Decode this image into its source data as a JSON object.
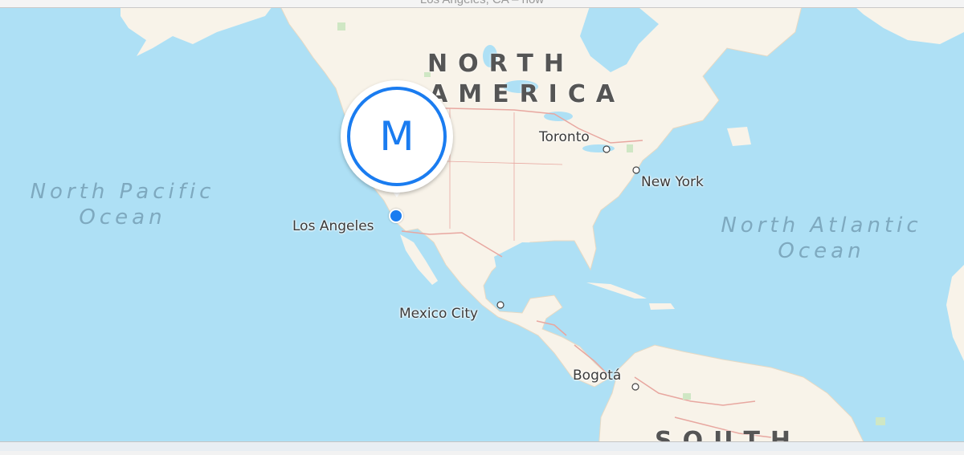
{
  "window": {
    "title": "Los Angeles, CA – now"
  },
  "colors": {
    "ocean": "#aee0f5",
    "land": "#f8f3e9",
    "border": "#e8a7a0",
    "pin": "#1a7cf0"
  },
  "map": {
    "continents": [
      {
        "id": "north-america",
        "line1": "NORTH",
        "line2": "AMERICA"
      },
      {
        "id": "south-america",
        "line1": "SOUTH"
      }
    ],
    "oceans": [
      {
        "id": "north-pacific",
        "line1": "North Pacific",
        "line2": "Ocean"
      },
      {
        "id": "north-atlantic",
        "line1": "North Atlantic",
        "line2": "Ocean"
      }
    ],
    "cities": [
      {
        "id": "toronto",
        "name": "Toronto"
      },
      {
        "id": "new-york",
        "name": "New York"
      },
      {
        "id": "los-angeles",
        "name": "Los Angeles"
      },
      {
        "id": "mexico-city",
        "name": "Mexico City"
      },
      {
        "id": "bogota",
        "name": "Bogotá"
      }
    ],
    "pin": {
      "initial": "M",
      "icon": "location-pin-icon"
    },
    "current_location": {
      "icon": "current-location-dot-icon"
    }
  }
}
